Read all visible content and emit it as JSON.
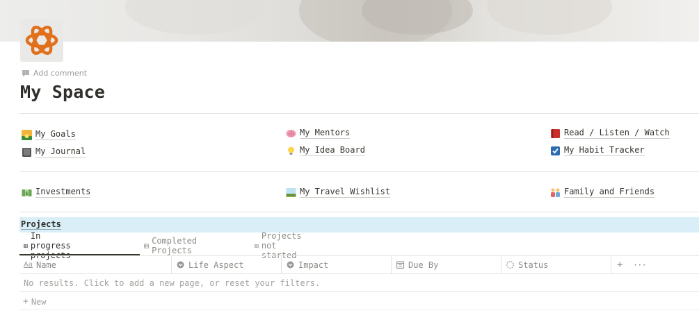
{
  "page": {
    "title": "My Space",
    "add_comment": "Add comment",
    "icon": "orange-atom-knot-icon"
  },
  "links_row1": [
    {
      "label": "My Goals",
      "icon": "sunrise-emoji"
    },
    {
      "label": "My Mentors",
      "icon": "brain-emoji"
    },
    {
      "label": "Read / Listen / Watch",
      "icon": "red-book-emoji"
    }
  ],
  "links_row2": [
    {
      "label": "My Journal",
      "icon": "notebook-emoji"
    },
    {
      "label": "My Idea Board",
      "icon": "lightbulb-emoji"
    },
    {
      "label": "My Habit Tracker",
      "icon": "check-box-emoji"
    }
  ],
  "links_row3": [
    {
      "label": "Investments",
      "icon": "money-emoji"
    },
    {
      "label": "My Travel Wishlist",
      "icon": "railway-emoji"
    },
    {
      "label": "Family and Friends",
      "icon": "family-emoji"
    }
  ],
  "projects": {
    "heading": "Projects",
    "heading_bg": "#d9eef6",
    "tabs": [
      {
        "label": "In progress projects",
        "active": true
      },
      {
        "label": "Completed Projects",
        "active": false
      },
      {
        "label": "Projects not started",
        "active": false
      }
    ],
    "columns": [
      {
        "label": "Name",
        "icon": "text-aa-icon"
      },
      {
        "label": "Life Aspect",
        "icon": "select-icon"
      },
      {
        "label": "Impact",
        "icon": "select-icon"
      },
      {
        "label": "Due By",
        "icon": "calendar-icon"
      },
      {
        "label": "Status",
        "icon": "status-icon"
      }
    ],
    "add_column": "+",
    "more": "···",
    "empty_message": "No results. Click to add a new page, or reset your filters.",
    "new_label": "New"
  },
  "colors": {
    "text": "#37352f",
    "muted": "#8c8b87",
    "accent_icon": "#e0701c"
  }
}
